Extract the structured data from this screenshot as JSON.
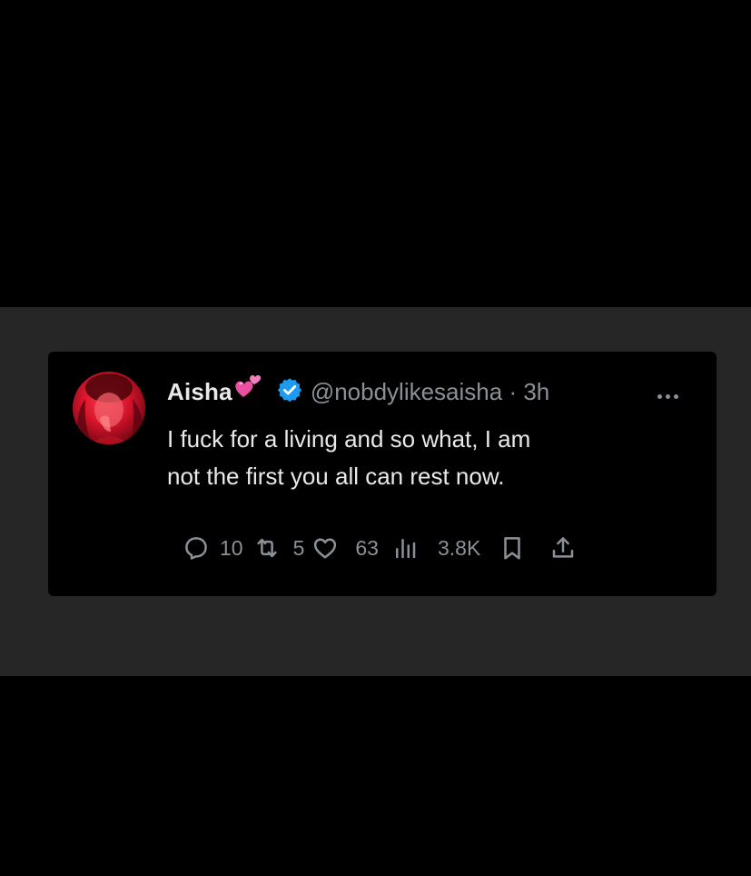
{
  "tweet": {
    "author": {
      "display_name": "Aisha",
      "handle": "@nobdylikesaisha",
      "time_sep": " · ",
      "time": "3h",
      "verified": true,
      "emoji": "two-hearts-emoji"
    },
    "text_line_1": "I fuck for a living and so what, I am",
    "text_line_2": "not the first you all can rest now.",
    "stats": {
      "replies": "10",
      "reposts": "5",
      "likes": "63",
      "views": "3.8K"
    }
  },
  "colors": {
    "page_bg": "#000000",
    "band_bg": "#262626",
    "card_bg": "#000000",
    "text_primary": "#e7e9ea",
    "text_secondary": "#8b9096",
    "verified_blue": "#1d9bf0",
    "heart_pink": "#ec4fa0"
  },
  "icons": {
    "reply": "speech-bubble-icon",
    "repost": "repost-arrows-icon",
    "like": "heart-outline-icon",
    "views": "bar-chart-icon",
    "bookmark": "bookmark-icon",
    "share": "share-upload-icon",
    "more": "ellipsis-icon",
    "verified": "verified-badge-icon"
  }
}
